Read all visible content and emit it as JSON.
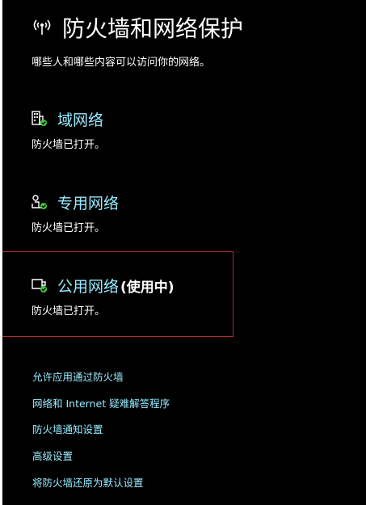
{
  "header": {
    "icon": "wifi-signal-icon",
    "title": "防火墙和网络保护",
    "subtitle": "哪些人和哪些内容可以访问你的网络。"
  },
  "networks": [
    {
      "icon": "domain-network-icon",
      "label": "域网络",
      "status": "防火墙已打开。"
    },
    {
      "icon": "private-network-icon",
      "label": "专用网络",
      "status": "防火墙已打开。"
    },
    {
      "icon": "public-network-icon",
      "label": "公用网络",
      "active_tag": "(使用中)",
      "status": "防火墙已打开。"
    }
  ],
  "links": [
    "允许应用通过防火墙",
    "网络和 Internet 疑难解答程序",
    "防火墙通知设置",
    "高级设置",
    "将防火墙还原为默认设置"
  ],
  "colors": {
    "background": "#000000",
    "accent": "#99ebff",
    "text": "#ffffff",
    "check": "#3cc83c",
    "highlight_border": "#b02a2a"
  }
}
